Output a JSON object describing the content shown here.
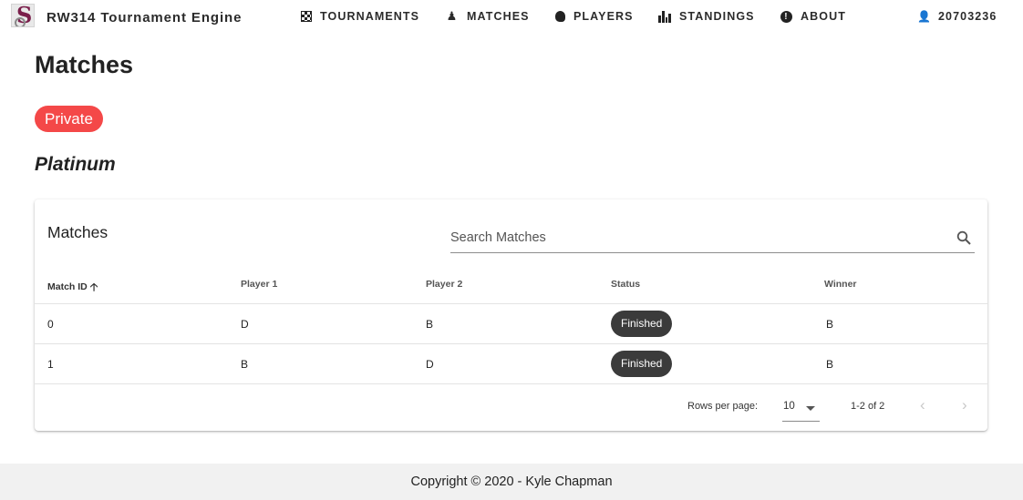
{
  "header": {
    "brand": "RW314 Tournament Engine",
    "nav": [
      {
        "label": "TOURNAMENTS",
        "icon": "chessboard-icon"
      },
      {
        "label": "MATCHES",
        "icon": "chess-pawn-icon"
      },
      {
        "label": "PLAYERS",
        "icon": "head-profile-icon"
      },
      {
        "label": "STANDINGS",
        "icon": "bar-chart-icon"
      },
      {
        "label": "ABOUT",
        "icon": "info-icon"
      }
    ],
    "user": {
      "id": "20703236",
      "icon": "user-gear-icon"
    }
  },
  "page": {
    "title": "Matches",
    "visibility": "Private",
    "tournament_name": "Platinum"
  },
  "table": {
    "title": "Matches",
    "search_placeholder": "Search Matches",
    "columns": [
      "Match ID",
      "Player 1",
      "Player 2",
      "Status",
      "Winner"
    ],
    "sort": {
      "column": "Match ID",
      "direction": "ascending"
    },
    "rows": [
      {
        "match_id": "0",
        "player1": "D",
        "player2": "B",
        "status": "Finished",
        "winner": "B"
      },
      {
        "match_id": "1",
        "player1": "B",
        "player2": "D",
        "status": "Finished",
        "winner": "B"
      }
    ],
    "pagination": {
      "rows_per_page_label": "Rows per page:",
      "rows_per_page": "10",
      "range": "1-2 of 2"
    }
  },
  "footer": {
    "copyright": "Copyright © 2020 - Kyle Chapman"
  },
  "colors": {
    "private_chip": "#f44848",
    "status_chip": "#3b3b3b",
    "footer_bg": "#f1f1f1",
    "logo_accent": "#7a1f4b"
  }
}
